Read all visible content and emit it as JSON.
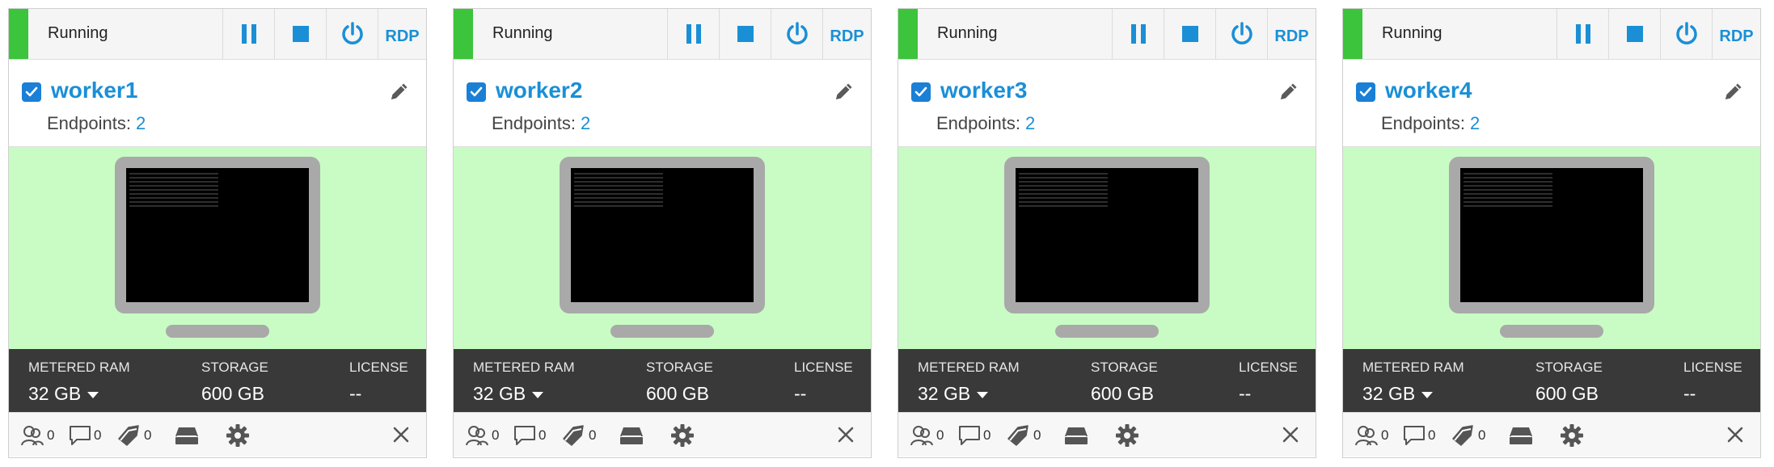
{
  "colors": {
    "running_accent": "#3cc43c",
    "link_blue": "#1a8fd6",
    "preview_bg": "#c8fcc4",
    "specs_bg": "#393939"
  },
  "labels": {
    "endpoints": "Endpoints:",
    "metered_ram": "METERED RAM",
    "storage": "STORAGE",
    "license": "LICENSE",
    "rdp": "RDP"
  },
  "icons": [
    "pause-icon",
    "stop-icon",
    "power-icon",
    "pencil-icon",
    "checkbox-checked-icon",
    "users-icon",
    "comment-icon",
    "tag-icon",
    "drive-icon",
    "gear-icon",
    "close-icon"
  ],
  "cards": [
    {
      "name": "worker1",
      "status": "Running",
      "endpoints": "2",
      "ram": "32 GB",
      "storage": "600 GB",
      "license": "--",
      "users_count": "0",
      "comments_count": "0",
      "tags_count": "0"
    },
    {
      "name": "worker2",
      "status": "Running",
      "endpoints": "2",
      "ram": "32 GB",
      "storage": "600 GB",
      "license": "--",
      "users_count": "0",
      "comments_count": "0",
      "tags_count": "0"
    },
    {
      "name": "worker3",
      "status": "Running",
      "endpoints": "2",
      "ram": "32 GB",
      "storage": "600 GB",
      "license": "--",
      "users_count": "0",
      "comments_count": "0",
      "tags_count": "0"
    },
    {
      "name": "worker4",
      "status": "Running",
      "endpoints": "2",
      "ram": "32 GB",
      "storage": "600 GB",
      "license": "--",
      "users_count": "0",
      "comments_count": "0",
      "tags_count": "0"
    }
  ]
}
